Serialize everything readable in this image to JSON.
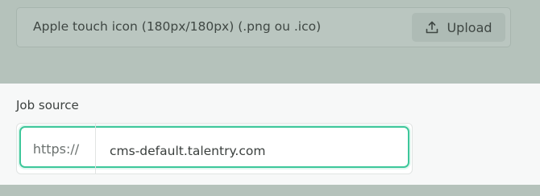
{
  "favicon_upload": {
    "label": "Apple touch icon (180px/180px) (.png ou .ico)",
    "button_label": "Upload",
    "icon": "upload-icon"
  },
  "job_source": {
    "label": "Job source",
    "prefix": "https://",
    "value": "cms-default.talentry.com"
  },
  "colors": {
    "focus_border": "#3dc79a",
    "overlay": "#b5c2bb",
    "section_background": "#f7f8f8"
  }
}
